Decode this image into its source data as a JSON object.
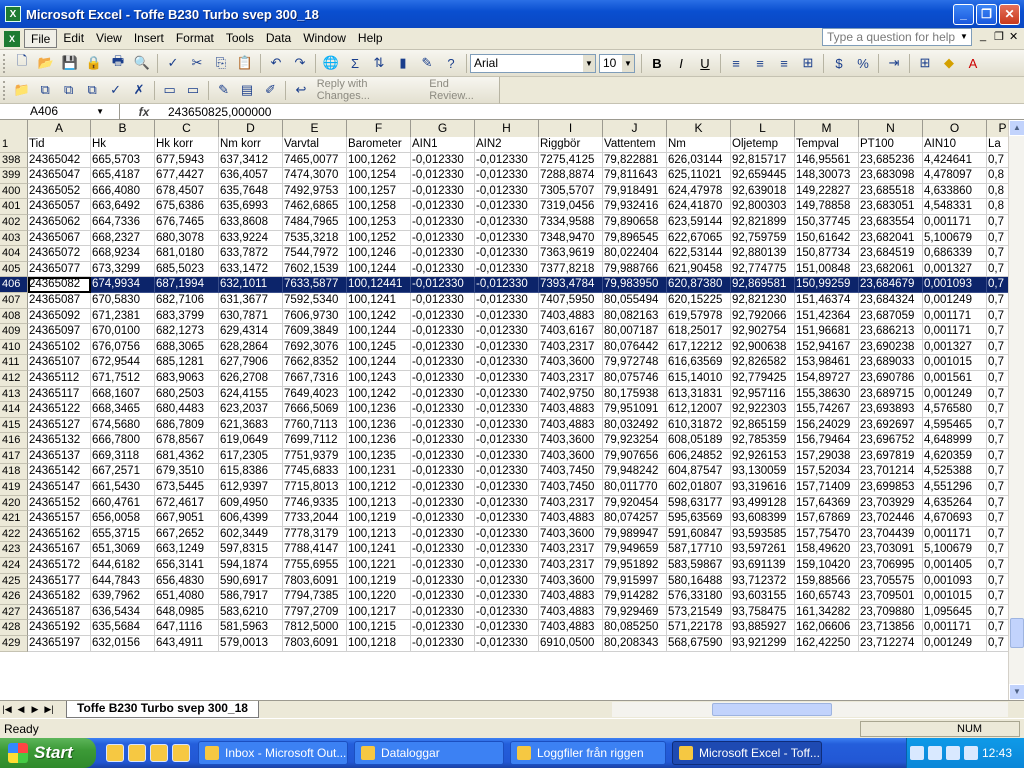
{
  "window": {
    "title": "Microsoft Excel - Toffe B230 Turbo svep 300_18"
  },
  "menu": {
    "items": [
      "File",
      "Edit",
      "View",
      "Insert",
      "Format",
      "Tools",
      "Data",
      "Window",
      "Help"
    ],
    "help_placeholder": "Type a question for help"
  },
  "format_toolbar": {
    "font": "Arial",
    "size": "10",
    "bold": "B",
    "italic": "I",
    "underline": "U"
  },
  "reviewing_toolbar": {
    "reply": "Reply with Changes...",
    "end": "End Review..."
  },
  "formula_bar": {
    "name_box": "A406",
    "fx": "fx",
    "formula": "243650825,000000"
  },
  "grid": {
    "columns": [
      {
        "letter": "A",
        "name": "Tid"
      },
      {
        "letter": "B",
        "name": "Hk"
      },
      {
        "letter": "C",
        "name": "Hk korr"
      },
      {
        "letter": "D",
        "name": "Nm korr"
      },
      {
        "letter": "E",
        "name": "Varvtal"
      },
      {
        "letter": "F",
        "name": "Barometer"
      },
      {
        "letter": "G",
        "name": "AIN1"
      },
      {
        "letter": "H",
        "name": "AIN2"
      },
      {
        "letter": "I",
        "name": "Riggbör"
      },
      {
        "letter": "J",
        "name": "Vattentem"
      },
      {
        "letter": "K",
        "name": "Nm"
      },
      {
        "letter": "L",
        "name": "Oljetemp"
      },
      {
        "letter": "M",
        "name": "Tempval"
      },
      {
        "letter": "N",
        "name": "PT100"
      },
      {
        "letter": "O",
        "name": "AIN10"
      },
      {
        "letter": "P",
        "name": "La"
      }
    ],
    "header_row_num": "1",
    "selected_row": "406",
    "rows": [
      {
        "n": "398",
        "c": [
          "24365042",
          "665,5703",
          "677,5943",
          "637,3412",
          "7465,0077",
          "100,1262",
          "-0,012330",
          "-0,012330",
          "7275,4125",
          "79,822881",
          "626,03144",
          "92,815717",
          "146,95561",
          "23,685236",
          "4,424641",
          "0,7"
        ]
      },
      {
        "n": "399",
        "c": [
          "24365047",
          "665,4187",
          "677,4427",
          "636,4057",
          "7474,3070",
          "100,1254",
          "-0,012330",
          "-0,012330",
          "7288,8874",
          "79,811643",
          "625,11021",
          "92,659445",
          "148,30073",
          "23,683098",
          "4,478097",
          "0,8"
        ]
      },
      {
        "n": "400",
        "c": [
          "24365052",
          "666,4080",
          "678,4507",
          "635,7648",
          "7492,9753",
          "100,1257",
          "-0,012330",
          "-0,012330",
          "7305,5707",
          "79,918491",
          "624,47978",
          "92,639018",
          "149,22827",
          "23,685518",
          "4,633860",
          "0,8"
        ]
      },
      {
        "n": "401",
        "c": [
          "24365057",
          "663,6492",
          "675,6386",
          "635,6993",
          "7462,6865",
          "100,1258",
          "-0,012330",
          "-0,012330",
          "7319,0456",
          "79,932416",
          "624,41870",
          "92,800303",
          "149,78858",
          "23,683051",
          "4,548331",
          "0,8"
        ]
      },
      {
        "n": "402",
        "c": [
          "24365062",
          "664,7336",
          "676,7465",
          "633,8608",
          "7484,7965",
          "100,1253",
          "-0,012330",
          "-0,012330",
          "7334,9588",
          "79,890658",
          "623,59144",
          "92,821899",
          "150,37745",
          "23,683554",
          "0,001171",
          "0,7"
        ]
      },
      {
        "n": "403",
        "c": [
          "24365067",
          "668,2327",
          "680,3078",
          "633,9224",
          "7535,3218",
          "100,1252",
          "-0,012330",
          "-0,012330",
          "7348,9470",
          "79,896545",
          "622,67065",
          "92,759759",
          "150,61642",
          "23,682041",
          "5,100679",
          "0,7"
        ]
      },
      {
        "n": "404",
        "c": [
          "24365072",
          "668,9234",
          "681,0180",
          "633,7872",
          "7544,7972",
          "100,1246",
          "-0,012330",
          "-0,012330",
          "7363,9619",
          "80,022404",
          "622,53144",
          "92,880139",
          "150,87734",
          "23,684519",
          "0,686339",
          "0,7"
        ]
      },
      {
        "n": "405",
        "c": [
          "24365077",
          "673,3299",
          "685,5023",
          "633,1472",
          "7602,1539",
          "100,1244",
          "-0,012330",
          "-0,012330",
          "7377,8218",
          "79,988766",
          "621,90458",
          "92,774775",
          "151,00848",
          "23,682061",
          "0,001327",
          "0,7"
        ]
      },
      {
        "n": "406",
        "c": [
          "24365082",
          "674,9934",
          "687,1994",
          "632,1011",
          "7633,5877",
          "100,12441",
          "-0,012330",
          "-0,012330",
          "7393,4784",
          "79,983950",
          "620,87380",
          "92,869581",
          "150,99259",
          "23,684679",
          "0,001093",
          "0,7"
        ]
      },
      {
        "n": "407",
        "c": [
          "24365087",
          "670,5830",
          "682,7106",
          "631,3677",
          "7592,5340",
          "100,1241",
          "-0,012330",
          "-0,012330",
          "7407,5950",
          "80,055494",
          "620,15225",
          "92,821230",
          "151,46374",
          "23,684324",
          "0,001249",
          "0,7"
        ]
      },
      {
        "n": "408",
        "c": [
          "24365092",
          "671,2381",
          "683,3799",
          "630,7871",
          "7606,9730",
          "100,1242",
          "-0,012330",
          "-0,012330",
          "7403,4883",
          "80,082163",
          "619,57978",
          "92,792066",
          "151,42364",
          "23,687059",
          "0,001171",
          "0,7"
        ]
      },
      {
        "n": "409",
        "c": [
          "24365097",
          "670,0100",
          "682,1273",
          "629,4314",
          "7609,3849",
          "100,1244",
          "-0,012330",
          "-0,012330",
          "7403,6167",
          "80,007187",
          "618,25017",
          "92,902754",
          "151,96681",
          "23,686213",
          "0,001171",
          "0,7"
        ]
      },
      {
        "n": "410",
        "c": [
          "24365102",
          "676,0756",
          "688,3065",
          "628,2864",
          "7692,3076",
          "100,1245",
          "-0,012330",
          "-0,012330",
          "7403,2317",
          "80,076442",
          "617,12212",
          "92,900638",
          "152,94167",
          "23,690238",
          "0,001327",
          "0,7"
        ]
      },
      {
        "n": "411",
        "c": [
          "24365107",
          "672,9544",
          "685,1281",
          "627,7906",
          "7662,8352",
          "100,1244",
          "-0,012330",
          "-0,012330",
          "7403,3600",
          "79,972748",
          "616,63569",
          "92,826582",
          "153,98461",
          "23,689033",
          "0,001015",
          "0,7"
        ]
      },
      {
        "n": "412",
        "c": [
          "24365112",
          "671,7512",
          "683,9063",
          "626,2708",
          "7667,7316",
          "100,1243",
          "-0,012330",
          "-0,012330",
          "7403,2317",
          "80,075746",
          "615,14010",
          "92,779425",
          "154,89727",
          "23,690786",
          "0,001561",
          "0,7"
        ]
      },
      {
        "n": "413",
        "c": [
          "24365117",
          "668,1607",
          "680,2503",
          "624,4155",
          "7649,4023",
          "100,1242",
          "-0,012330",
          "-0,012330",
          "7402,9750",
          "80,175938",
          "613,31831",
          "92,957116",
          "155,38630",
          "23,689715",
          "0,001249",
          "0,7"
        ]
      },
      {
        "n": "414",
        "c": [
          "24365122",
          "668,3465",
          "680,4483",
          "623,2037",
          "7666,5069",
          "100,1236",
          "-0,012330",
          "-0,012330",
          "7403,4883",
          "79,951091",
          "612,12007",
          "92,922303",
          "155,74267",
          "23,693893",
          "4,576580",
          "0,7"
        ]
      },
      {
        "n": "415",
        "c": [
          "24365127",
          "674,5680",
          "686,7809",
          "621,3683",
          "7760,7113",
          "100,1236",
          "-0,012330",
          "-0,012330",
          "7403,4883",
          "80,032492",
          "610,31872",
          "92,865159",
          "156,24029",
          "23,692697",
          "4,595465",
          "0,7"
        ]
      },
      {
        "n": "416",
        "c": [
          "24365132",
          "666,7800",
          "678,8567",
          "619,0649",
          "7699,7112",
          "100,1236",
          "-0,012330",
          "-0,012330",
          "7403,3600",
          "79,923254",
          "608,05189",
          "92,785359",
          "156,79464",
          "23,696752",
          "4,648999",
          "0,7"
        ]
      },
      {
        "n": "417",
        "c": [
          "24365137",
          "669,3118",
          "681,4362",
          "617,2305",
          "7751,9379",
          "100,1235",
          "-0,012330",
          "-0,012330",
          "7403,3600",
          "79,907656",
          "606,24852",
          "92,926153",
          "157,29038",
          "23,697819",
          "4,620359",
          "0,7"
        ]
      },
      {
        "n": "418",
        "c": [
          "24365142",
          "667,2571",
          "679,3510",
          "615,8386",
          "7745,6833",
          "100,1231",
          "-0,012330",
          "-0,012330",
          "7403,7450",
          "79,948242",
          "604,87547",
          "93,130059",
          "157,52034",
          "23,701214",
          "4,525388",
          "0,7"
        ]
      },
      {
        "n": "419",
        "c": [
          "24365147",
          "661,5430",
          "673,5445",
          "612,9397",
          "7715,8013",
          "100,1212",
          "-0,012330",
          "-0,012330",
          "7403,7450",
          "80,011770",
          "602,01807",
          "93,319616",
          "157,71409",
          "23,699853",
          "4,551296",
          "0,7"
        ]
      },
      {
        "n": "420",
        "c": [
          "24365152",
          "660,4761",
          "672,4617",
          "609,4950",
          "7746,9335",
          "100,1213",
          "-0,012330",
          "-0,012330",
          "7403,2317",
          "79,920454",
          "598,63177",
          "93,499128",
          "157,64369",
          "23,703929",
          "4,635264",
          "0,7"
        ]
      },
      {
        "n": "421",
        "c": [
          "24365157",
          "656,0058",
          "667,9051",
          "606,4399",
          "7733,2044",
          "100,1219",
          "-0,012330",
          "-0,012330",
          "7403,4883",
          "80,074257",
          "595,63569",
          "93,608399",
          "157,67869",
          "23,702446",
          "4,670693",
          "0,7"
        ]
      },
      {
        "n": "422",
        "c": [
          "24365162",
          "655,3715",
          "667,2652",
          "602,3449",
          "7778,3179",
          "100,1213",
          "-0,012330",
          "-0,012330",
          "7403,3600",
          "79,989947",
          "591,60847",
          "93,593585",
          "157,75470",
          "23,704439",
          "0,001171",
          "0,7"
        ]
      },
      {
        "n": "423",
        "c": [
          "24365167",
          "651,3069",
          "663,1249",
          "597,8315",
          "7788,4147",
          "100,1241",
          "-0,012330",
          "-0,012330",
          "7403,2317",
          "79,949659",
          "587,17710",
          "93,597261",
          "158,49620",
          "23,703091",
          "5,100679",
          "0,7"
        ]
      },
      {
        "n": "424",
        "c": [
          "24365172",
          "644,6182",
          "656,3141",
          "594,1874",
          "7755,6955",
          "100,1221",
          "-0,012330",
          "-0,012330",
          "7403,2317",
          "79,951892",
          "583,59867",
          "93,691139",
          "159,10420",
          "23,706995",
          "0,001405",
          "0,7"
        ]
      },
      {
        "n": "425",
        "c": [
          "24365177",
          "644,7843",
          "656,4830",
          "590,6917",
          "7803,6091",
          "100,1219",
          "-0,012330",
          "-0,012330",
          "7403,3600",
          "79,915997",
          "580,16488",
          "93,712372",
          "159,88566",
          "23,705575",
          "0,001093",
          "0,7"
        ]
      },
      {
        "n": "426",
        "c": [
          "24365182",
          "639,7962",
          "651,4080",
          "586,7917",
          "7794,7385",
          "100,1220",
          "-0,012330",
          "-0,012330",
          "7403,4883",
          "79,914282",
          "576,33180",
          "93,603155",
          "160,65743",
          "23,709501",
          "0,001015",
          "0,7"
        ]
      },
      {
        "n": "427",
        "c": [
          "24365187",
          "636,5434",
          "648,0985",
          "583,6210",
          "7797,2709",
          "100,1217",
          "-0,012330",
          "-0,012330",
          "7403,4883",
          "79,929469",
          "573,21549",
          "93,758475",
          "161,34282",
          "23,709880",
          "1,095645",
          "0,7"
        ]
      },
      {
        "n": "428",
        "c": [
          "24365192",
          "635,5684",
          "647,1116",
          "581,5963",
          "7812,5000",
          "100,1215",
          "-0,012330",
          "-0,012330",
          "7403,4883",
          "80,085250",
          "571,22178",
          "93,885927",
          "162,06606",
          "23,713856",
          "0,001171",
          "0,7"
        ]
      },
      {
        "n": "429",
        "c": [
          "24365197",
          "632,0156",
          "643,4911",
          "579,0013",
          "7803,6091",
          "100,1218",
          "-0,012330",
          "-0,012330",
          "6910,0500",
          "80,208343",
          "568,67590",
          "93,921299",
          "162,42250",
          "23,712274",
          "0,001249",
          "0,7"
        ]
      }
    ]
  },
  "sheet": {
    "tab": "Toffe B230 Turbo svep 300_18"
  },
  "status": {
    "left": "Ready",
    "num": "NUM"
  },
  "taskbar": {
    "start": "Start",
    "tasks": [
      "Inbox - Microsoft Out...",
      "Dataloggar",
      "Loggfiler från riggen",
      "Microsoft Excel - Toff..."
    ],
    "time": "12:43"
  }
}
